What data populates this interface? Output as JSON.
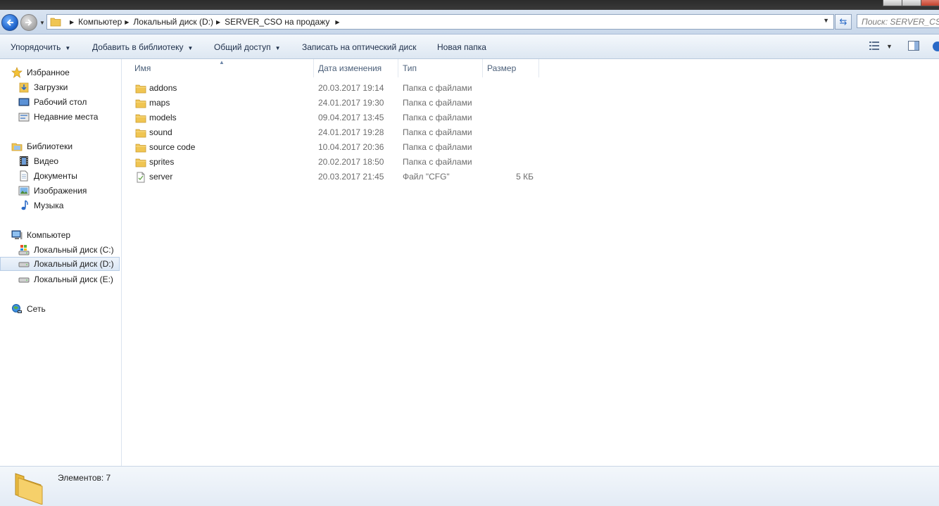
{
  "address": {
    "crumbs": [
      "Компьютер",
      "Локальный диск (D:)",
      "SERVER_CSO на продажу"
    ],
    "search_placeholder": "Поиск: SERVER_CS..."
  },
  "toolbar": {
    "organize": "Упорядочить",
    "add_library": "Добавить в библиотеку",
    "share": "Общий доступ",
    "burn": "Записать на оптический диск",
    "new_folder": "Новая папка"
  },
  "nav": {
    "favorites": {
      "label": "Избранное",
      "items": [
        "Загрузки",
        "Рабочий стол",
        "Недавние места"
      ]
    },
    "libraries": {
      "label": "Библиотеки",
      "items": [
        "Видео",
        "Документы",
        "Изображения",
        "Музыка"
      ]
    },
    "computer": {
      "label": "Компьютер",
      "items": [
        "Локальный диск (C:)",
        "Локальный диск (D:)",
        "Локальный диск (E:)"
      ]
    },
    "network": {
      "label": "Сеть"
    }
  },
  "columns": {
    "name": "Имя",
    "date": "Дата изменения",
    "type": "Тип",
    "size": "Размер"
  },
  "files": [
    {
      "name": "addons",
      "date": "20.03.2017 19:14",
      "type": "Папка с файлами",
      "size": "",
      "icon": "folder-icon"
    },
    {
      "name": "maps",
      "date": "24.01.2017 19:30",
      "type": "Папка с файлами",
      "size": "",
      "icon": "folder-icon"
    },
    {
      "name": "models",
      "date": "09.04.2017 13:45",
      "type": "Папка с файлами",
      "size": "",
      "icon": "folder-icon"
    },
    {
      "name": "sound",
      "date": "24.01.2017 19:28",
      "type": "Папка с файлами",
      "size": "",
      "icon": "folder-icon"
    },
    {
      "name": "source code",
      "date": "10.04.2017 20:36",
      "type": "Папка с файлами",
      "size": "",
      "icon": "folder-icon"
    },
    {
      "name": "sprites",
      "date": "20.02.2017 18:50",
      "type": "Папка с файлами",
      "size": "",
      "icon": "folder-icon"
    },
    {
      "name": "server",
      "date": "20.03.2017 21:45",
      "type": "Файл \"CFG\"",
      "size": "5 КБ",
      "icon": "cfg-file-icon"
    }
  ],
  "status": {
    "count": "Элементов: 7"
  },
  "colors": {
    "toolbar_text": "#1e2f4a",
    "header_text": "#4c607a",
    "meta_text": "#6d6d6d",
    "folder": "#f0c552"
  }
}
